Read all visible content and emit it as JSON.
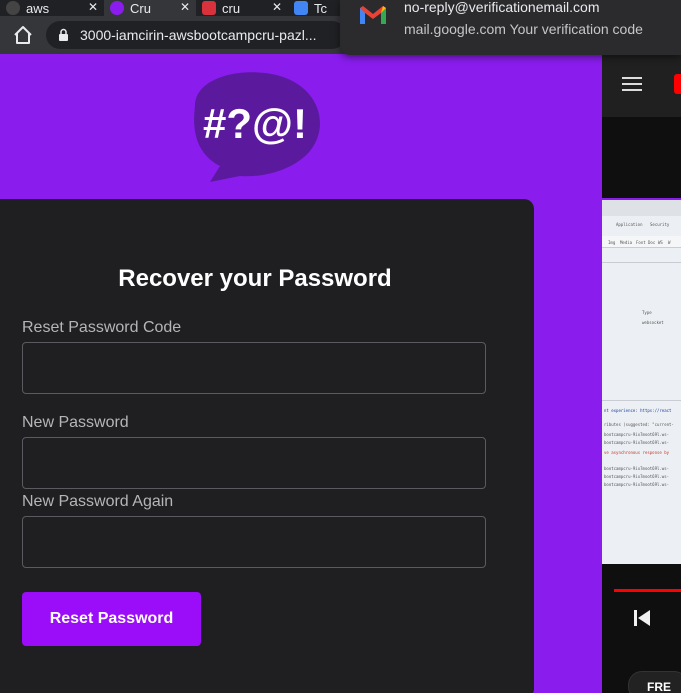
{
  "browser": {
    "tabs": [
      {
        "label": "aws",
        "favicon_color": "#444444"
      },
      {
        "label": "Cru",
        "favicon_color": "#8a1dee"
      },
      {
        "label": "cru",
        "favicon_color": "#d9323d"
      },
      {
        "label": "Tc",
        "favicon_color": "#4285f4"
      }
    ],
    "url": "3000-iamcirin-awsbootcampcru-pazl..."
  },
  "notification": {
    "from": "no-reply@verificationemail.com",
    "body": "mail.google.com   Your verification code",
    "icon": "gmail-icon"
  },
  "app": {
    "logo_text": "#?@!",
    "form": {
      "title": "Recover your Password",
      "fields": [
        {
          "label": "Reset Password Code",
          "value": ""
        },
        {
          "label": "New Password",
          "value": ""
        },
        {
          "label": "New Password Again",
          "value": ""
        }
      ],
      "submit_label": "Reset Password"
    },
    "colors": {
      "brand_purple": "#8a1dee",
      "button_purple": "#9b0cf8",
      "card_bg": "#1f1f22"
    }
  },
  "side_panel": {
    "thumbnail_lines": [
      "nt experience: https://react",
      "ributes (suggested: \"current-",
      "bootcampcru-9ix7moot69l.ws-",
      "bootcampcru-9ix7moot69l.ws-",
      "ve asynchronous response by",
      "bootcampcru-9ix7moot69l.ws-",
      "bootcampcru-9ix7moot69l.ws-",
      "bootcampcru-9ix7moot69l.ws-"
    ],
    "thumbnail_header_items": [
      "Application",
      "Security"
    ],
    "thumbnail_filter_items": [
      "Img",
      "Media",
      "Font",
      "Doc",
      "WS",
      "W"
    ],
    "thumbnail_col_type": "Type",
    "thumbnail_row_type": "websocket",
    "bottom_chip": "FRE"
  }
}
